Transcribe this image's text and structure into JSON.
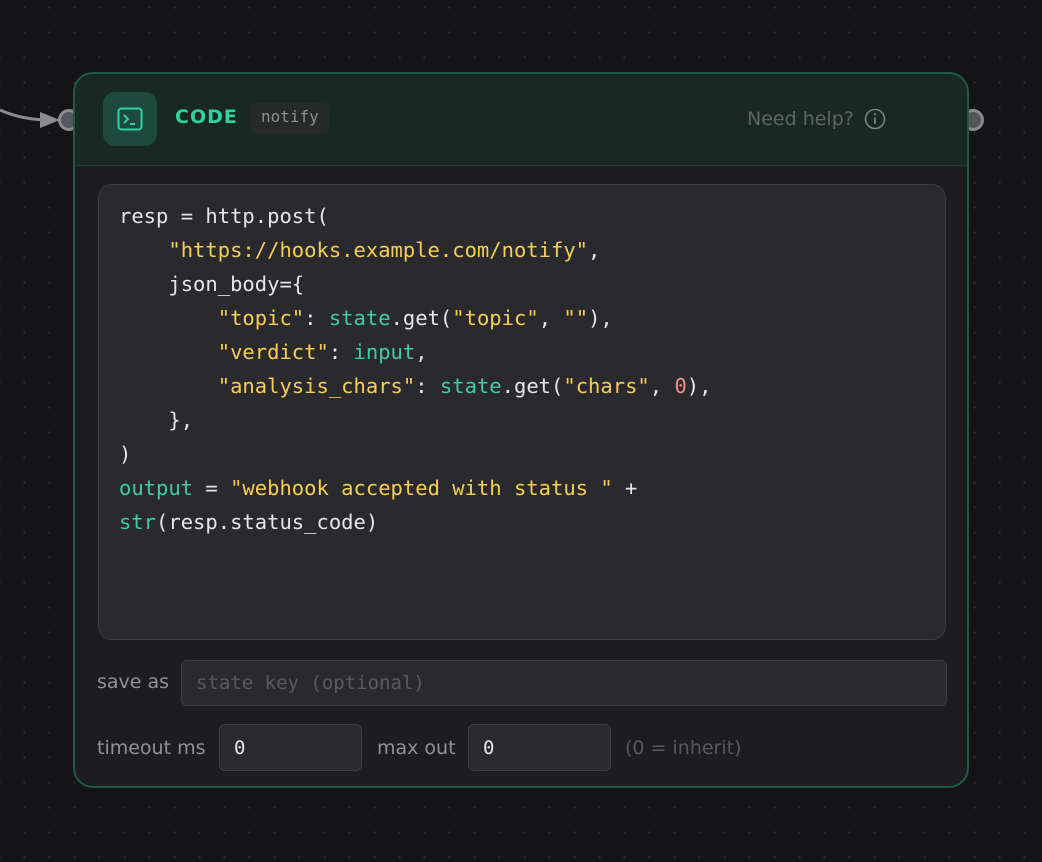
{
  "node": {
    "type_label": "CODE",
    "name": "notify",
    "help_label": "Need help?",
    "icon": "terminal-icon",
    "accent_color": "#2fd3a0"
  },
  "code_lines": [
    [
      {
        "t": "resp = http.post(",
        "c": "plain"
      }
    ],
    [
      {
        "t": "    ",
        "c": "plain"
      },
      {
        "t": "\"https://hooks.example.com/notify\"",
        "c": "str"
      },
      {
        "t": ",",
        "c": "plain"
      }
    ],
    [
      {
        "t": "    json_body={",
        "c": "plain"
      }
    ],
    [
      {
        "t": "        ",
        "c": "plain"
      },
      {
        "t": "\"topic\"",
        "c": "str"
      },
      {
        "t": ": ",
        "c": "plain"
      },
      {
        "t": "state",
        "c": "kw"
      },
      {
        "t": ".get(",
        "c": "plain"
      },
      {
        "t": "\"topic\"",
        "c": "str"
      },
      {
        "t": ", ",
        "c": "plain"
      },
      {
        "t": "\"\"",
        "c": "str"
      },
      {
        "t": "),",
        "c": "plain"
      }
    ],
    [
      {
        "t": "        ",
        "c": "plain"
      },
      {
        "t": "\"verdict\"",
        "c": "str"
      },
      {
        "t": ": ",
        "c": "plain"
      },
      {
        "t": "input",
        "c": "kw"
      },
      {
        "t": ",",
        "c": "plain"
      }
    ],
    [
      {
        "t": "        ",
        "c": "plain"
      },
      {
        "t": "\"analysis_chars\"",
        "c": "str"
      },
      {
        "t": ": ",
        "c": "plain"
      },
      {
        "t": "state",
        "c": "kw"
      },
      {
        "t": ".get(",
        "c": "plain"
      },
      {
        "t": "\"chars\"",
        "c": "str"
      },
      {
        "t": ", ",
        "c": "plain"
      },
      {
        "t": "0",
        "c": "num"
      },
      {
        "t": "),",
        "c": "plain"
      }
    ],
    [
      {
        "t": "    },",
        "c": "plain"
      }
    ],
    [
      {
        "t": ")",
        "c": "plain"
      }
    ],
    [
      {
        "t": "output",
        "c": "kw"
      },
      {
        "t": " = ",
        "c": "plain"
      },
      {
        "t": "\"webhook accepted with status \"",
        "c": "str"
      },
      {
        "t": " +",
        "c": "plain"
      }
    ],
    [
      {
        "t": "str",
        "c": "kw"
      },
      {
        "t": "(resp.status_code)",
        "c": "plain"
      }
    ]
  ],
  "save_as": {
    "label": "save as",
    "value": "",
    "placeholder": "state key (optional)"
  },
  "timeout": {
    "label": "timeout ms",
    "value": "0"
  },
  "max_out": {
    "label": "max out",
    "value": "0"
  },
  "inherit_hint": "(0 = inherit)"
}
